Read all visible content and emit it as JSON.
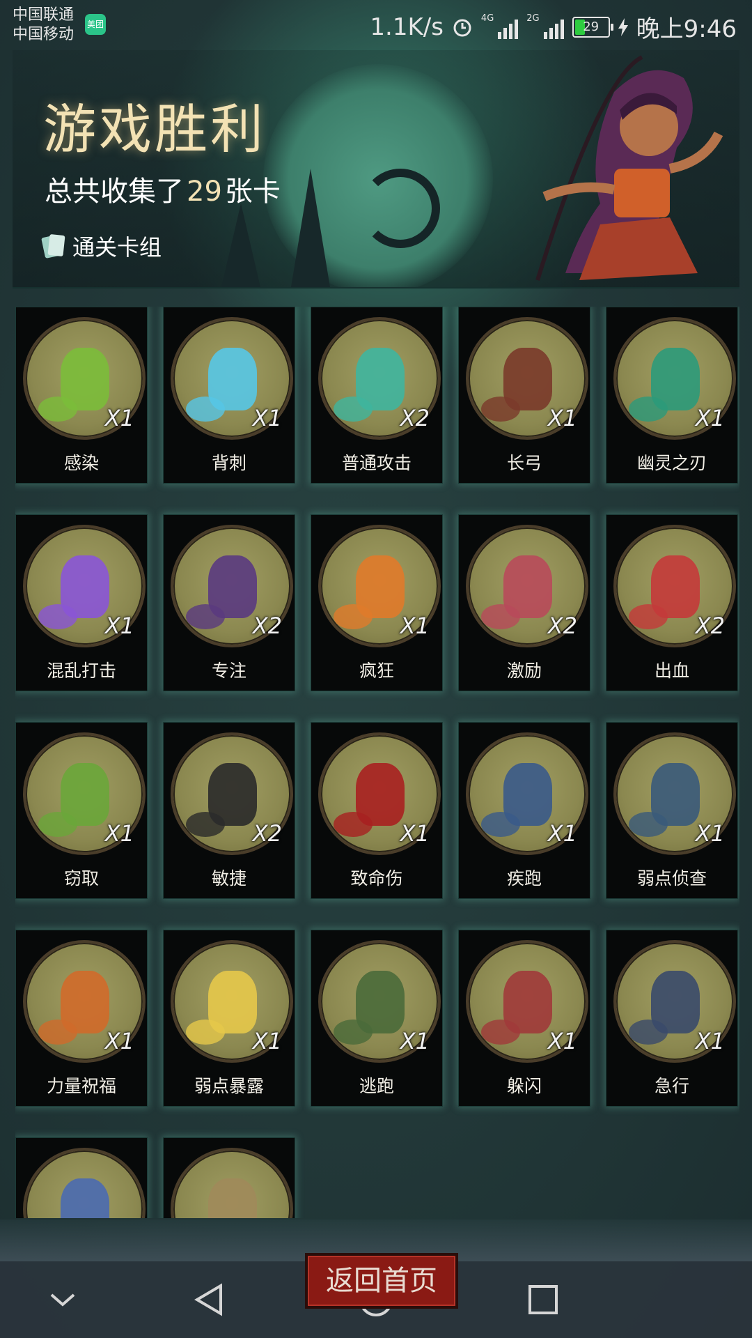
{
  "status_bar": {
    "carrier_1": "中国联通",
    "carrier_2": "中国移动",
    "app_badge": "美团",
    "net_speed": "1.1K/s",
    "net_4g": "4G",
    "net_2g": "2G",
    "battery": "29",
    "time": "晚上9:46",
    "icons": [
      "alarm-icon",
      "signal-icon",
      "battery-icon",
      "charging-icon"
    ]
  },
  "header": {
    "title": "游戏胜利",
    "subtitle_prefix": "总共收集了",
    "count": "29",
    "subtitle_suffix": "张卡",
    "deck_link": "通关卡组"
  },
  "cards": [
    {
      "name": "感染",
      "qty": "X1",
      "color": "#7bbd3a"
    },
    {
      "name": "背刺",
      "qty": "X1",
      "color": "#56c6e6"
    },
    {
      "name": "普通攻击",
      "qty": "X2",
      "color": "#3fb59e"
    },
    {
      "name": "长弓",
      "qty": "X1",
      "color": "#7a3a2a"
    },
    {
      "name": "幽灵之刃",
      "qty": "X1",
      "color": "#2c9a7a"
    },
    {
      "name": "混乱打击",
      "qty": "X1",
      "color": "#8a55d6"
    },
    {
      "name": "专注",
      "qty": "X2",
      "color": "#5a3a80"
    },
    {
      "name": "疯狂",
      "qty": "X1",
      "color": "#e07a2a"
    },
    {
      "name": "激励",
      "qty": "X2",
      "color": "#b84a5a"
    },
    {
      "name": "出血",
      "qty": "X2",
      "color": "#c43a3a"
    },
    {
      "name": "窃取",
      "qty": "X1",
      "color": "#6aa63a"
    },
    {
      "name": "敏捷",
      "qty": "X2",
      "color": "#2a2a2a"
    },
    {
      "name": "致命伤",
      "qty": "X1",
      "color": "#a82020"
    },
    {
      "name": "疾跑",
      "qty": "X1",
      "color": "#3a5a8a"
    },
    {
      "name": "弱点侦查",
      "qty": "X1",
      "color": "#3a5a7a"
    },
    {
      "name": "力量祝福",
      "qty": "X1",
      "color": "#d06a2a"
    },
    {
      "name": "弱点暴露",
      "qty": "X1",
      "color": "#e6c84a"
    },
    {
      "name": "逃跑",
      "qty": "X1",
      "color": "#4a6a3a"
    },
    {
      "name": "躲闪",
      "qty": "X1",
      "color": "#a03a3a"
    },
    {
      "name": "急行",
      "qty": "X1",
      "color": "#3a4a6a"
    },
    {
      "name": "",
      "qty": "",
      "color": "#4a6ab0"
    },
    {
      "name": "",
      "qty": "",
      "color": "#a08a5a"
    }
  ],
  "return_button": "返回首页",
  "nav": {
    "icons": [
      "chevron-down-icon",
      "back-icon",
      "home-icon",
      "recents-icon"
    ]
  }
}
